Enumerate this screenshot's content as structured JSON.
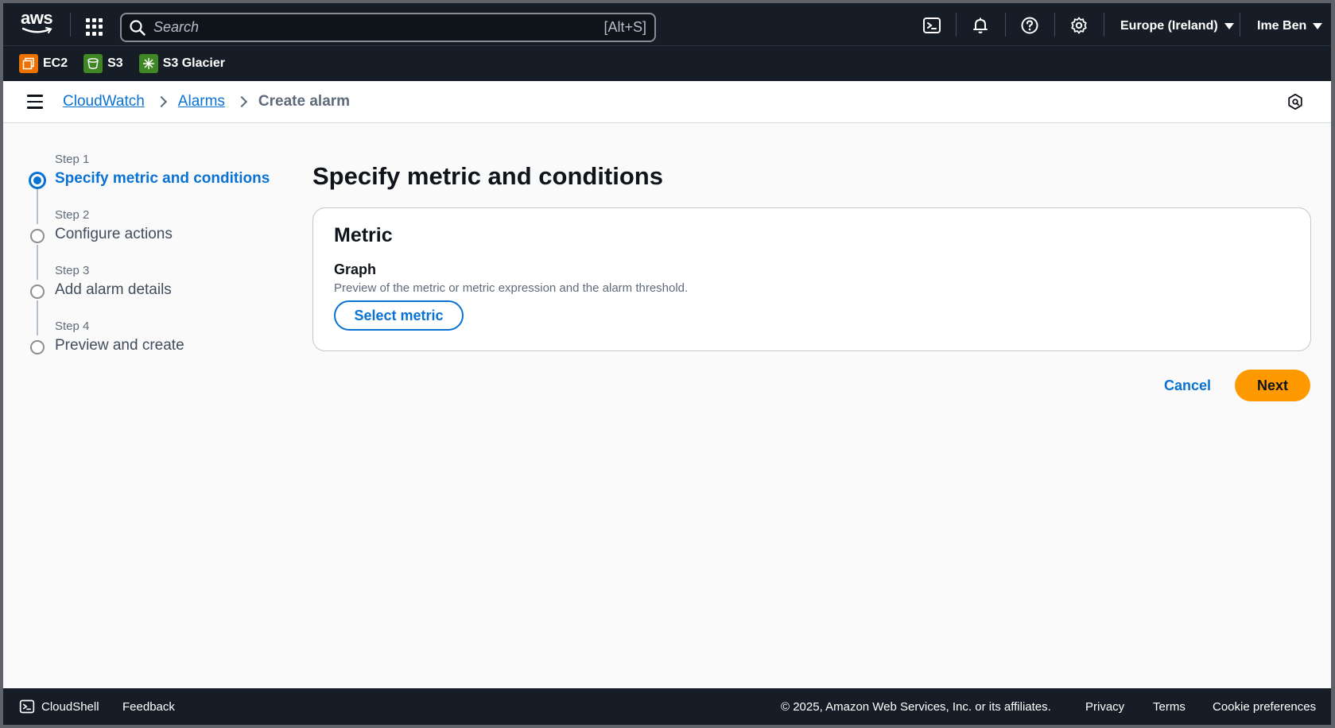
{
  "topbar": {
    "logo_text": "aws",
    "search_placeholder": "Search",
    "search_shortcut": "[Alt+S]",
    "region": "Europe (Ireland)",
    "user": "Ime Ben"
  },
  "favorites": [
    {
      "label": "EC2",
      "icon": "ec2-icon",
      "color": "#ed7100"
    },
    {
      "label": "S3",
      "icon": "s3-icon",
      "color": "#3f8624"
    },
    {
      "label": "S3 Glacier",
      "icon": "s3-glacier-icon",
      "color": "#3f8624"
    }
  ],
  "breadcrumb": {
    "items": [
      "CloudWatch",
      "Alarms"
    ],
    "current": "Create alarm"
  },
  "stepper": {
    "steps": [
      {
        "number": "Step 1",
        "title": "Specify metric and conditions"
      },
      {
        "number": "Step 2",
        "title": "Configure actions"
      },
      {
        "number": "Step 3",
        "title": "Add alarm details"
      },
      {
        "number": "Step 4",
        "title": "Preview and create"
      }
    ]
  },
  "main": {
    "title": "Specify metric and conditions",
    "panel": {
      "heading": "Metric",
      "graph_label": "Graph",
      "graph_description": "Preview of the metric or metric expression and the alarm threshold.",
      "select_button": "Select metric"
    },
    "cancel": "Cancel",
    "next": "Next"
  },
  "footer": {
    "cloudshell": "CloudShell",
    "feedback": "Feedback",
    "copyright": "© 2025, Amazon Web Services, Inc. or its affiliates.",
    "privacy": "Privacy",
    "terms": "Terms",
    "cookie": "Cookie preferences"
  },
  "colors": {
    "nav_bg": "#161d26",
    "link": "#0972d3",
    "primary_button": "#ff9900"
  }
}
